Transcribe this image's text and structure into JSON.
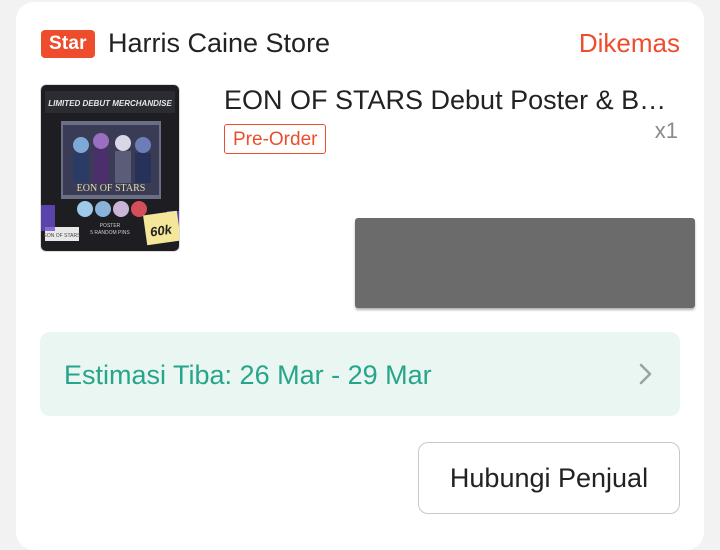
{
  "store": {
    "badge": "Star",
    "name": "Harris Caine Store",
    "status": "Dikemas"
  },
  "product": {
    "image_texts": {
      "banner": "LIMITED DEBUT MERCHANDISE",
      "logo": "EON OF STARS",
      "price_note": "60k",
      "sub_1": "POSTER",
      "sub_2": "5 RANDOM PINS",
      "brand": "EON OF STARS"
    },
    "title": "EON OF STARS Debut Poster & B…",
    "tag": "Pre-Order",
    "quantity": "x1"
  },
  "eta": {
    "label": "Estimasi Tiba: 26 Mar - 29 Mar"
  },
  "actions": {
    "contact_label": "Hubungi Penjual"
  },
  "colors": {
    "accent": "#ee4d2d",
    "eta_text": "#26a58a",
    "eta_bg": "#e9f6f2"
  }
}
